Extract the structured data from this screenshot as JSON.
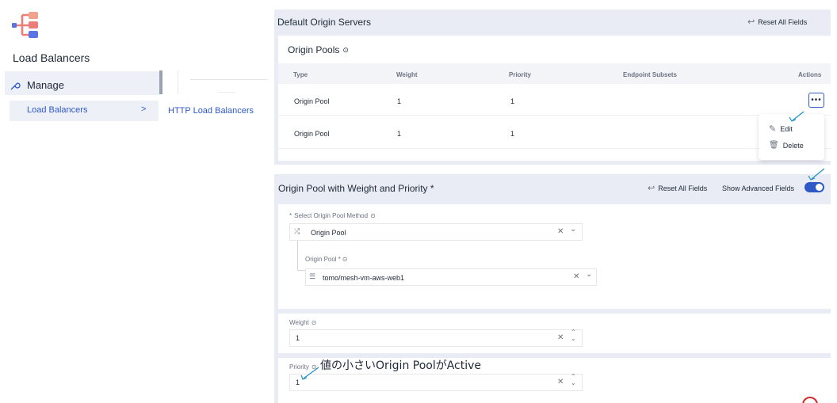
{
  "nav": {
    "title": "Load Balancers",
    "manage_label": "Manage",
    "load_balancers_label": "Load Balancers",
    "chevron": ">",
    "http_lb_label": "HTTP Load Balancers"
  },
  "default_origin": {
    "title": "Default Origin Servers",
    "reset_label": "Reset All Fields",
    "pools_title": "Origin Pools",
    "columns": [
      "Type",
      "Weight",
      "Priority",
      "Endpoint Subsets",
      "Actions"
    ],
    "rows": [
      {
        "type": "Origin Pool",
        "weight": "1",
        "priority": "1"
      },
      {
        "type": "Origin Pool",
        "weight": "1",
        "priority": "1"
      }
    ],
    "actions_button": "•••",
    "menu": {
      "edit": "Edit",
      "delete": "Delete"
    }
  },
  "weight_priority": {
    "title": "Origin Pool with Weight and Priority",
    "required_mark": "*",
    "reset_label": "Reset All Fields",
    "advanced_label": "Show Advanced Fields",
    "advanced_enabled": true,
    "method_label": "Select Origin Pool Method",
    "method_required": "*",
    "method_value": "Origin Pool",
    "origin_pool_label": "Origin Pool",
    "origin_pool_required": "*",
    "origin_pool_value": "tomo/mesh-vm-aws-web1",
    "weight_label": "Weight",
    "weight_value": "1",
    "priority_label": "Priority",
    "priority_value": "1",
    "clear_glyph": "✕",
    "chevron_glyph": "⌄"
  },
  "annotation": "値の小さいOrigin PoolがActive",
  "colors": {
    "accent": "#2f59c7",
    "pane": "#e9ecf4",
    "arrow": "#1e90c8"
  }
}
